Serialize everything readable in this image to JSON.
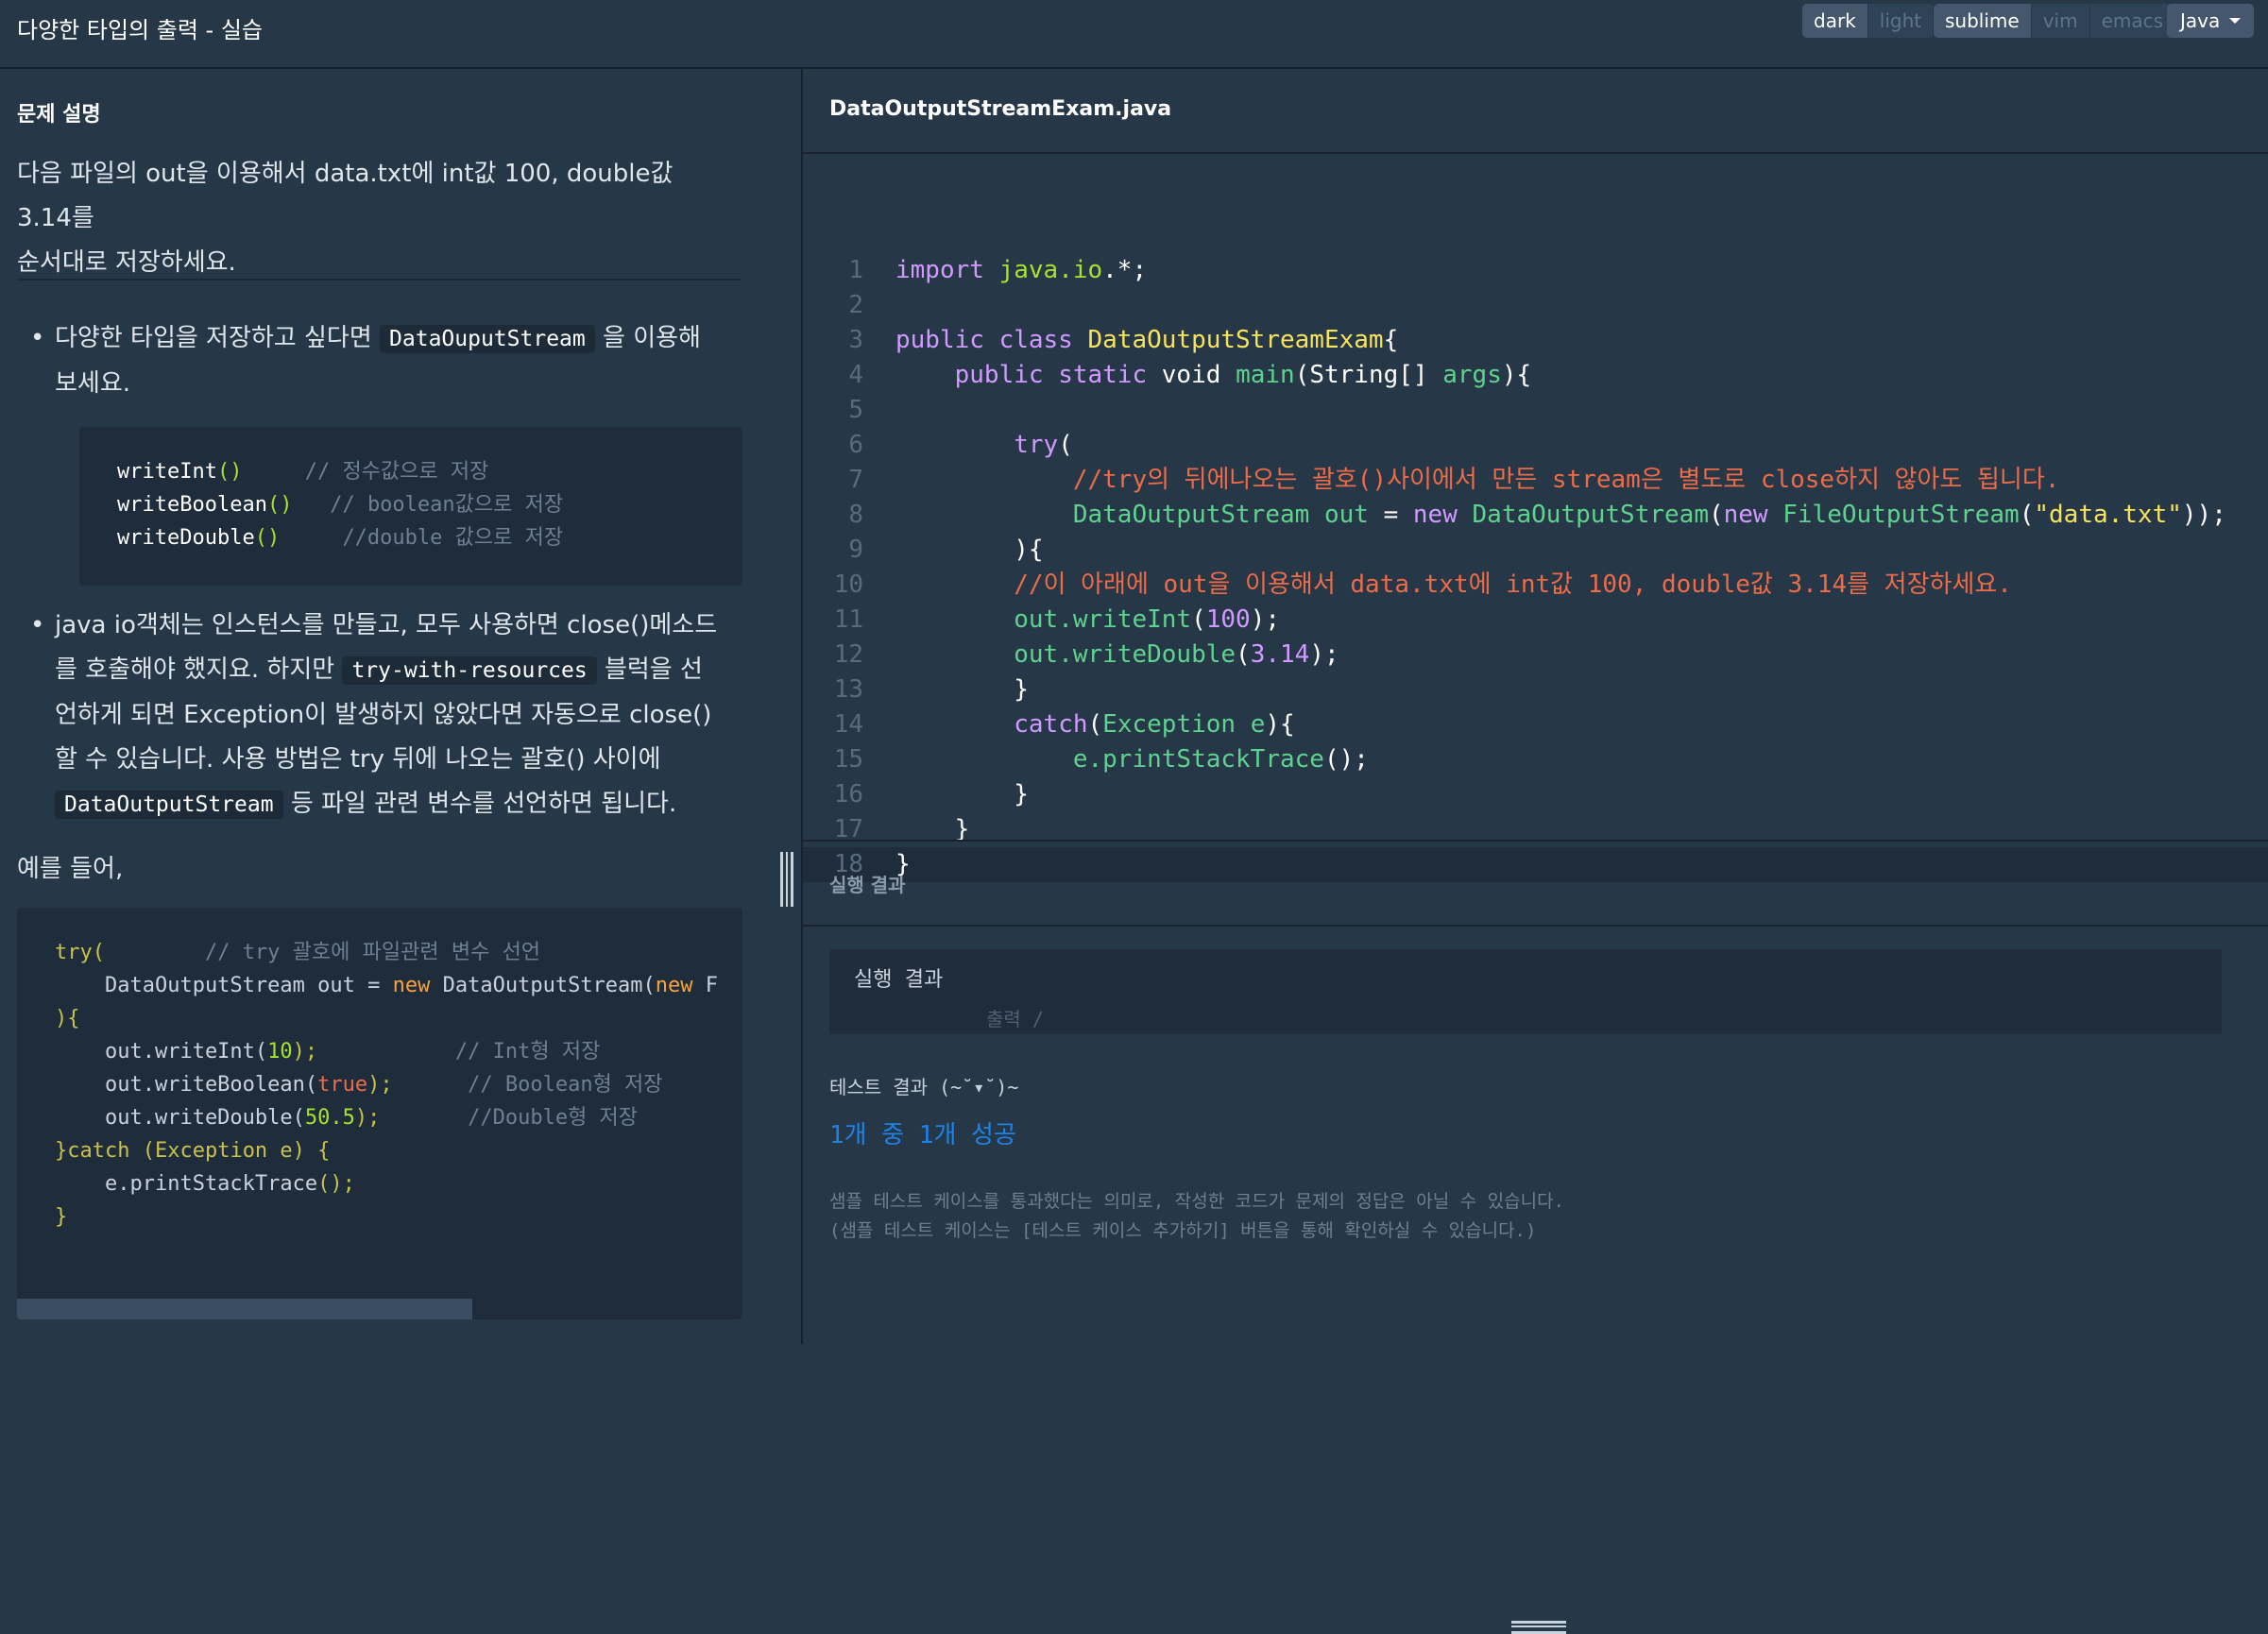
{
  "header": {
    "title": "다양한 타입의 출력 - 실습",
    "theme_options": [
      "dark",
      "light"
    ],
    "keymap_options": [
      "sublime",
      "vim",
      "emacs"
    ],
    "language": "Java",
    "colors": {
      "background": "#263747",
      "active_button": "#44576c",
      "success": "#1e83e7"
    }
  },
  "problem": {
    "section_title": "문제 설명",
    "description_line1": "다음 파일의 out을 이용해서 data.txt에 int값 100, double값 3.14를",
    "description_line2": "순서대로 저장하세요.",
    "bullet1": {
      "line1_a": "다양한 타입을 저장하고 싶다면",
      "code": "DataOuputStream",
      "line1_b": "을 이용해",
      "line2": "보세요."
    },
    "code_block": [
      {
        "method": "writeInt",
        "parens": "()",
        "comment": "// 정수값으로 저장"
      },
      {
        "method": "writeBoolean",
        "parens": "()",
        "comment": "// boolean값으로 저장"
      },
      {
        "method": "writeDouble",
        "parens": "()",
        "comment": "//double 값으로 저장"
      }
    ],
    "bullet2": {
      "line1": "java io객체는 인스턴스를 만들고, 모두 사용하면 close()메소드",
      "line2_a": "를 호출해야 했지요. 하지만",
      "code1": "try-with-resources",
      "line2_b": "블럭을 선",
      "line3": "언하게 되면 Exception이 발생하지 않았다면 자동으로 close()",
      "line4": "할 수 있습니다. 사용 방법은 try 뒤에 나오는 괄호() 사이에",
      "code2": "DataOutputStream",
      "line5_b": "등 파일 관련 변수를 선언하면 됩니다."
    },
    "example_label": "예를 들어,",
    "example": {
      "l1_kw": "try(",
      "l1_cmt": "// try 괄호에 파일관련 변수 선언",
      "l2_a": "    DataOutputStream out = ",
      "l2_new": "new",
      "l2_b": " DataOutputStream(",
      "l2_new2": "new",
      "l2_c": " F",
      "l3": "){",
      "l4_a": "    out.writeInt(",
      "l4_num": "10",
      "l4_b": ");",
      "l4_cmt": "// Int형 저장",
      "l5_a": "    out.writeBoolean(",
      "l5_bool": "true",
      "l5_b": ");",
      "l5_cmt": "// Boolean형 저장",
      "l6_a": "    out.writeDouble(",
      "l6_num": "50.5",
      "l6_b": ");",
      "l6_cmt": "//Double형 저장",
      "l7_kw": "}catch",
      "l7_b": " (Exception e) {",
      "l8_a": "    e.printStackTrace",
      "l8_b": "();",
      "l9": "}"
    }
  },
  "editor": {
    "filename": "DataOutputStreamExam.java",
    "line_numbers": [
      "1",
      "2",
      "3",
      "4",
      "5",
      "6",
      "7",
      "8",
      "9",
      "10",
      "11",
      "12",
      "13",
      "14",
      "15",
      "16",
      "17",
      "18"
    ],
    "code": {
      "l1_import": "import",
      "l1_pkg": "java.io",
      "l1_rest": ".*;",
      "l3_kw": "public class",
      "l3_cls": "DataOutputStreamExam",
      "l3_brace": "{",
      "l4_kw": "public static",
      "l4_void": "void",
      "l4_fn": "main",
      "l4_params": "(String[]",
      "l4_args": "args",
      "l4_end": "){",
      "l6_try": "try",
      "l6_paren": "(",
      "l7_comment": "//try의 뒤에나오는 괄호()사이에서 만든 stream은 별도로 close하지 않아도 됩니다.",
      "l8_cls": "DataOutputStream",
      "l8_var": "out",
      "l8_eq": " = ",
      "l8_new": "new",
      "l8_cls2": "DataOutputStream",
      "l8_p1": "(",
      "l8_new2": "new",
      "l8_cls3": "FileOutputStream",
      "l8_p2": "(",
      "l8_str": "\"data.txt\"",
      "l8_end": "));",
      "l9": "){",
      "l10_comment": "//이 아래에 out을 이용해서 data.txt에 int값 100, double값 3.14를 저장하세요.",
      "l11_var": "out",
      "l11_fn": ".writeInt",
      "l11_p": "(",
      "l11_num": "100",
      "l11_end": ");",
      "l12_var": "out",
      "l12_fn": ".writeDouble",
      "l12_p": "(",
      "l12_num": "3.14",
      "l12_end": ");",
      "l13": "}",
      "l14_catch": "catch",
      "l14_p": "(",
      "l14_cls": "Exception",
      "l14_e": "e",
      "l14_end": "){",
      "l15_e": "e",
      "l15_fn": ".printStackTrace",
      "l15_end": "();",
      "l16": "}",
      "l17": "}",
      "l18": "}"
    }
  },
  "results": {
    "title": "실행 결과",
    "output_label": "실행 결과",
    "output_text": "출력 /",
    "test_label": "테스트 결과 (~˘▾˘)~",
    "test_result": "1개 중 1개 성공",
    "note_line1": "샘플 테스트 케이스를 통과했다는 의미로, 작성한 코드가 문제의 정답은 아닐 수 있습니다.",
    "note_line2": "(샘플 테스트 케이스는 [테스트 케이스 추가하기] 버튼을 통해 확인하실 수 있습니다.)"
  }
}
